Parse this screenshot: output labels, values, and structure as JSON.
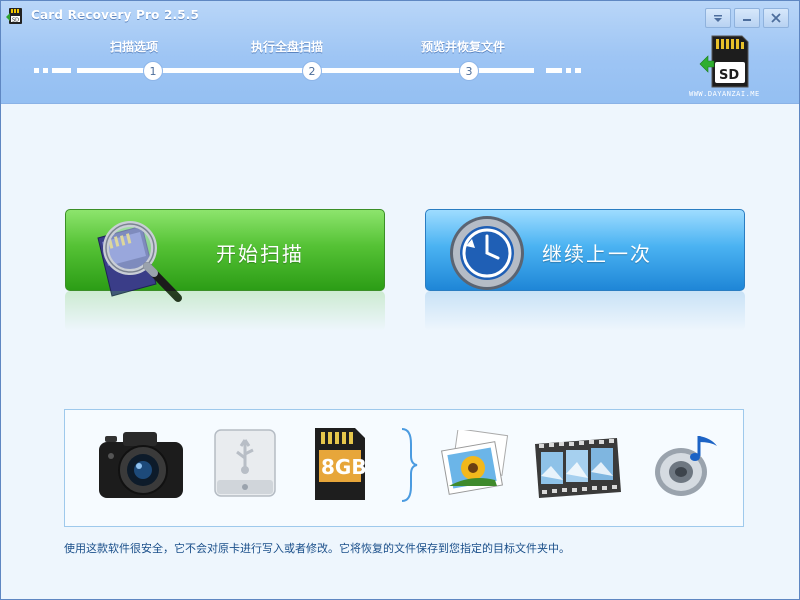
{
  "window": {
    "title": "Card Recovery Pro 2.5.5"
  },
  "title_controls": {
    "menu_icon": "menu-dropdown-icon",
    "minimize_icon": "minimize-icon",
    "close_icon": "close-icon"
  },
  "steps": [
    {
      "number": "1",
      "label": "扫描选项"
    },
    {
      "number": "2",
      "label": "执行全盘扫描"
    },
    {
      "number": "3",
      "label": "预览并恢复文件"
    }
  ],
  "brand": {
    "logo_text": "SD",
    "site_text": "WWW.DAYANZAI.ME"
  },
  "buttons": {
    "start_scan": {
      "label": "开始扫描",
      "icon": "memory-card-magnifier-icon"
    },
    "continue_last": {
      "label": "继续上一次",
      "icon": "clock-restore-icon"
    }
  },
  "sources": [
    {
      "name": "camera",
      "icon": "camera-icon"
    },
    {
      "name": "usb-drive",
      "icon": "usb-drive-icon"
    },
    {
      "name": "sd-card",
      "icon": "sd-card-icon",
      "capacity": "8GB"
    },
    {
      "name": "photos",
      "icon": "photos-icon"
    },
    {
      "name": "video",
      "icon": "film-icon"
    },
    {
      "name": "music",
      "icon": "music-speaker-icon"
    }
  ],
  "footer": {
    "note": "使用这款软件很安全，它不会对原卡进行写入或者修改。它将恢复的文件保存到您指定的目标文件夹中。"
  },
  "colors": {
    "header": "#9ec5f4",
    "green_button": "#55c235",
    "blue_button": "#4bb3f2",
    "footer_text": "#1a4f8a"
  }
}
